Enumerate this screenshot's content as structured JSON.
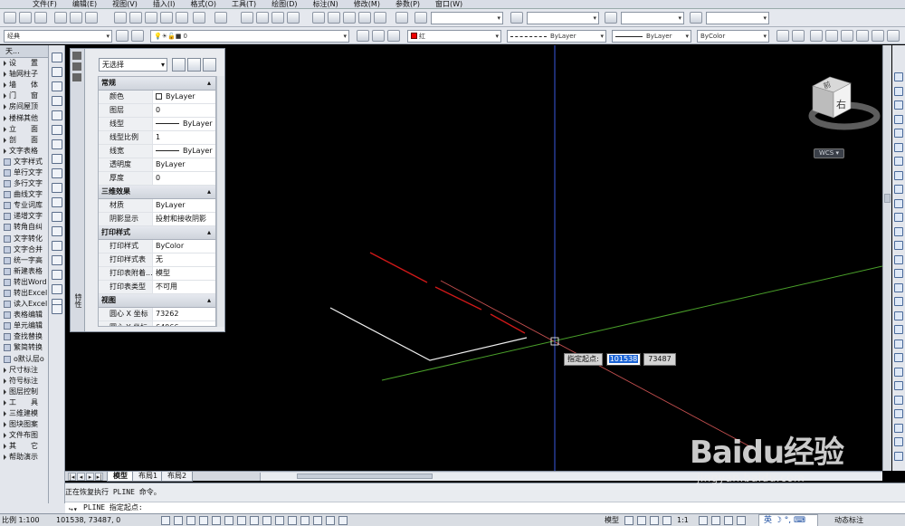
{
  "menu": [
    "文件(F)",
    "编辑(E)",
    "视图(V)",
    "插入(I)",
    "格式(O)",
    "工具(T)",
    "绘图(D)",
    "标注(N)",
    "修改(M)",
    "参数(P)",
    "窗口(W)"
  ],
  "toolbar": {
    "workspace": "经典",
    "layer_value": "0",
    "color_value": "红",
    "linetype_value": "ByLayer",
    "lineweight_value": "ByLayer",
    "plotstyle_value": "ByColor"
  },
  "left_palette": {
    "header": "天...",
    "items": [
      "设　　置",
      "轴网柱子",
      "墙　　体",
      "门　　窗",
      "房间屋顶",
      "楼梯其他",
      "立　　面",
      "剖　　面",
      "文字表格",
      "文字样式",
      "单行文字",
      "多行文字",
      "曲线文字",
      "专业词库",
      "递增文字",
      "转角自纠",
      "文字转化",
      "文字合并",
      "统一字高",
      "新建表格",
      "转出Word",
      "转出Excel",
      "读入Excel",
      "表格编辑",
      "单元编辑",
      "查找替换",
      "繁简转换",
      "o默认层o",
      "尺寸标注",
      "符号标注",
      "图层控制",
      "工　　具",
      "三维建模",
      "图块图案",
      "文件布图",
      "其　　它",
      "帮助演示"
    ]
  },
  "properties": {
    "selection": "无选择",
    "vertical_label": "特性",
    "sections": [
      {
        "title": "常规",
        "rows": [
          {
            "k": "颜色",
            "v": "ByLayer",
            "kind": "color"
          },
          {
            "k": "图层",
            "v": "0"
          },
          {
            "k": "线型",
            "v": "ByLayer",
            "kind": "line"
          },
          {
            "k": "线型比例",
            "v": "1"
          },
          {
            "k": "线宽",
            "v": "ByLayer",
            "kind": "line"
          },
          {
            "k": "透明度",
            "v": "ByLayer"
          },
          {
            "k": "厚度",
            "v": "0"
          }
        ]
      },
      {
        "title": "三维效果",
        "rows": [
          {
            "k": "材质",
            "v": "ByLayer"
          },
          {
            "k": "阴影显示",
            "v": "投射和接收阴影"
          }
        ]
      },
      {
        "title": "打印样式",
        "rows": [
          {
            "k": "打印样式",
            "v": "ByColor"
          },
          {
            "k": "打印样式表",
            "v": "无"
          },
          {
            "k": "打印表附着...",
            "v": "模型"
          },
          {
            "k": "打印表类型",
            "v": "不可用"
          }
        ]
      },
      {
        "title": "视图",
        "rows": [
          {
            "k": "圆心 X 坐标",
            "v": "73262"
          },
          {
            "k": "圆心 Y 坐标",
            "v": "64066"
          }
        ]
      }
    ]
  },
  "viewcube": {
    "face": "右",
    "top_face": "前",
    "wcs": "WCS"
  },
  "dynamic_input": {
    "label": "指定起点:",
    "x": "101538",
    "y": "73487"
  },
  "tabs": [
    "模型",
    "布局1",
    "布局2"
  ],
  "command": {
    "history": "正在恢复执行 PLINE 命令。",
    "prompt": "PLINE 指定起点:"
  },
  "status": {
    "scale": "比例 1:100",
    "coords": "101538,  73487,  0",
    "model_label": "模型",
    "anno_scale": "1:1",
    "dyn_label": "动态标注"
  },
  "watermark": {
    "logo": "Baidu经验",
    "url": "jingyan.baidu.com"
  },
  "colors": {
    "canvas": "#000000",
    "red_line": "#d01818",
    "green_line": "#4aa02a",
    "white_line": "#f0f0f0",
    "crosshair_v": "#3a5ae0",
    "crosshair_h": "#d05050"
  }
}
